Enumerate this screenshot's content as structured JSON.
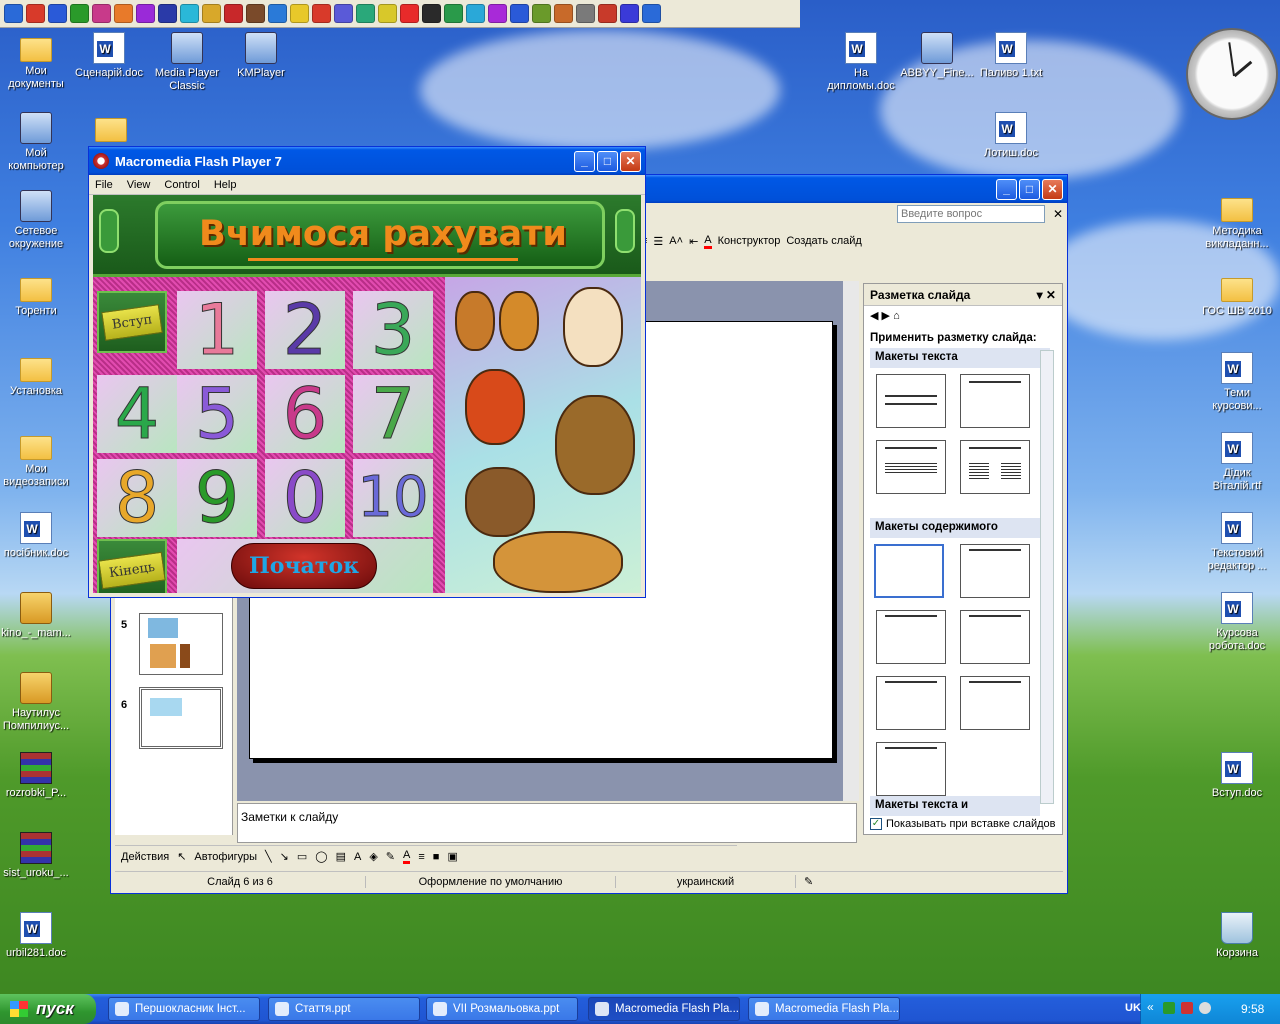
{
  "desktop": {
    "icons": [
      {
        "id": "my-docs",
        "label": "Мои документы",
        "type": "folder"
      },
      {
        "id": "scenario",
        "label": "Сценарій.doc",
        "type": "doc"
      },
      {
        "id": "mpc",
        "label": "Media Player Classic",
        "type": "app"
      },
      {
        "id": "kmp",
        "label": "KMPlayer",
        "type": "app"
      },
      {
        "id": "folder-blank",
        "label": "",
        "type": "folder"
      },
      {
        "id": "my-computer",
        "label": "Мой компьютер",
        "type": "comp"
      },
      {
        "id": "network",
        "label": "Сетевое окружение",
        "type": "comp"
      },
      {
        "id": "torrents",
        "label": "Торенти",
        "type": "folder"
      },
      {
        "id": "install",
        "label": "Установка",
        "type": "folder"
      },
      {
        "id": "my-videos",
        "label": "Мои видеозаписи",
        "type": "folder"
      },
      {
        "id": "posibnyk",
        "label": "посібник.doc",
        "type": "doc"
      },
      {
        "id": "kino",
        "label": "kino_-_mam...",
        "type": "shortcut"
      },
      {
        "id": "nautilus",
        "label": "Наутилус Помпилиус...",
        "type": "shortcut"
      },
      {
        "id": "rozrobki",
        "label": "rozrobki_P...",
        "type": "rar"
      },
      {
        "id": "sist",
        "label": "sist_uroku_...",
        "type": "rar"
      },
      {
        "id": "urbil",
        "label": "urbil281.doc",
        "type": "doc"
      },
      {
        "id": "diplomy",
        "label": "На дипломы.doc",
        "type": "doc"
      },
      {
        "id": "abbyy",
        "label": "ABBYY_Fine...",
        "type": "app"
      },
      {
        "id": "palyvo",
        "label": "Паливо 1.txt",
        "type": "txt"
      },
      {
        "id": "lotysh",
        "label": "Лотиш.doc",
        "type": "doc"
      },
      {
        "id": "metodyka",
        "label": "Методика викладанн...",
        "type": "folder"
      },
      {
        "id": "gos",
        "label": "ГОС ШВ 2010",
        "type": "folder"
      },
      {
        "id": "temy",
        "label": "Теми курсови...",
        "type": "doc"
      },
      {
        "id": "didyk",
        "label": "Дідик Віталій.rtf",
        "type": "doc"
      },
      {
        "id": "textedit",
        "label": "Текстовий редактор ...",
        "type": "doc"
      },
      {
        "id": "kursova",
        "label": "Курсова робота.doc",
        "type": "doc"
      },
      {
        "id": "vstup",
        "label": "Вступ.doc",
        "type": "doc"
      },
      {
        "id": "trash",
        "label": "Корзина",
        "type": "trash"
      }
    ]
  },
  "flash": {
    "title": "Macromedia Flash Player 7",
    "menu": [
      "File",
      "View",
      "Control",
      "Help"
    ],
    "game_title": "Вчимося рахувати",
    "numbers": [
      "1",
      "2",
      "3",
      "4",
      "5",
      "6",
      "7",
      "8",
      "9",
      "0",
      "10"
    ],
    "intro_btn": "Вступ",
    "end_btn": "Кінець",
    "start_btn": "Початок"
  },
  "ppt": {
    "ask_placeholder": "Введите вопрос",
    "toolbar": {
      "designer": "Конструктор",
      "create_slide": "Создать слайд"
    },
    "thumbs": [
      {
        "num": "5"
      },
      {
        "num": "6"
      }
    ],
    "notes": "Заметки к слайду",
    "taskpane": {
      "title": "Разметка слайда",
      "apply": "Применить разметку слайда:",
      "sec_text": "Макеты текста",
      "sec_content": "Макеты содержимого",
      "sec_text_and": "Макеты текста и",
      "show_on_insert": "Показывать при вставке слайдов"
    },
    "drawbar": {
      "actions": "Действия",
      "autoshapes": "Автофигуры"
    },
    "status": {
      "slide": "Слайд 6 из 6",
      "design": "Оформление по умолчанию",
      "lang": "украинский"
    }
  },
  "taskbar": {
    "start": "пуск",
    "tasks": [
      {
        "label": "Першокласник Інст...",
        "active": false
      },
      {
        "label": "Стаття.ppt",
        "active": false
      },
      {
        "label": "VII Розмальовка.ppt",
        "active": false
      },
      {
        "label": "Macromedia Flash Pla...",
        "active": true
      },
      {
        "label": "Macromedia Flash Pla...",
        "active": false
      }
    ],
    "lang": "UK",
    "time": "9:58"
  }
}
